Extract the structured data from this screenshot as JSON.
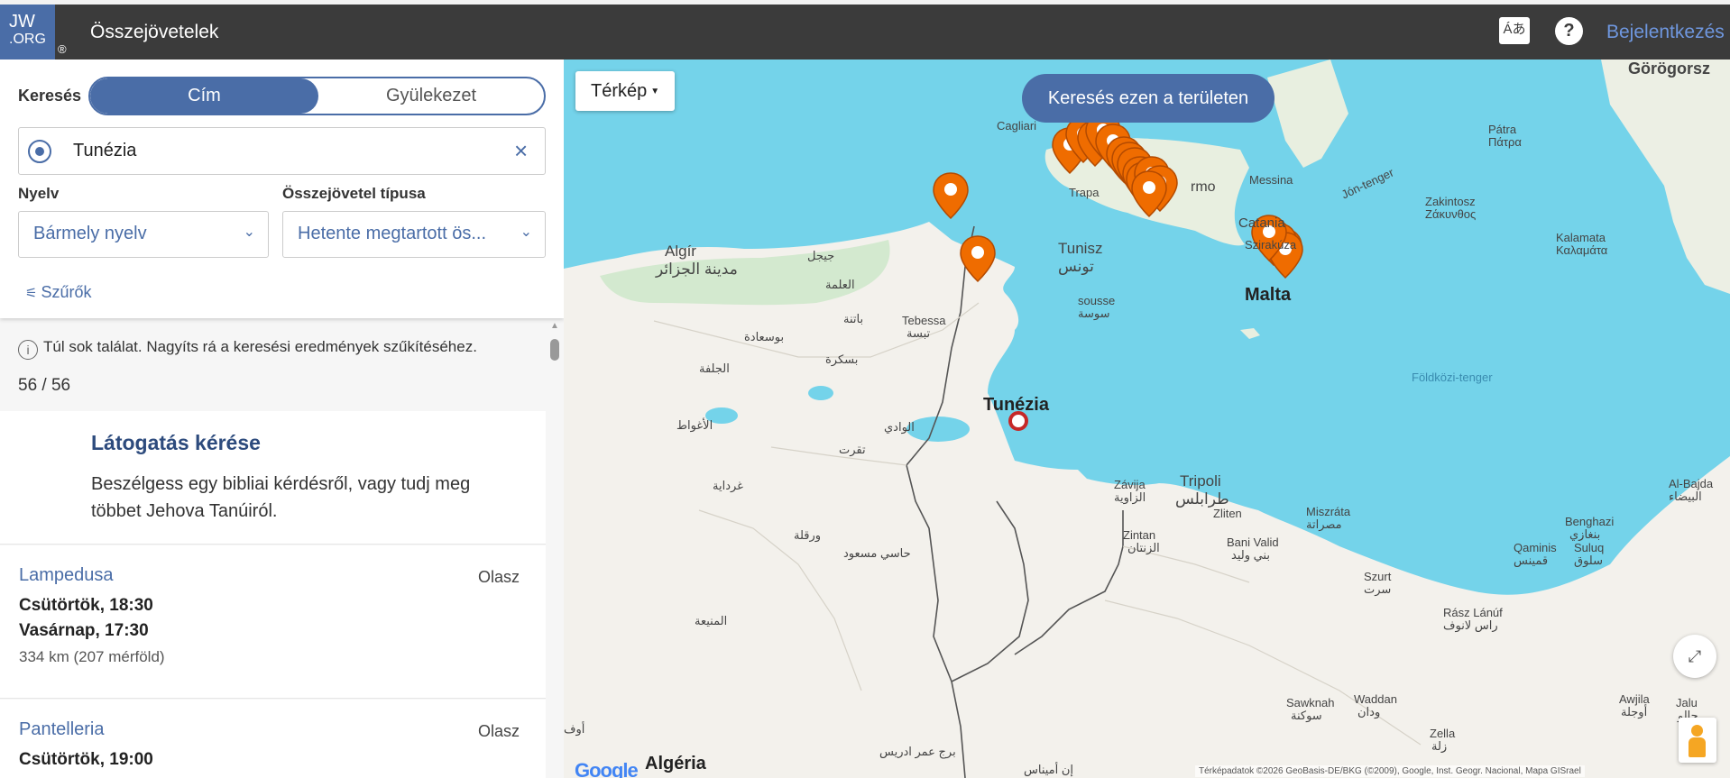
{
  "header": {
    "logo_line1": "JW",
    "logo_line2": ".ORG",
    "logo_reg": "®",
    "title": "Összejövetelek",
    "lang_icon_text": "Áあ",
    "help_icon_text": "?",
    "login": "Bejelentkezés"
  },
  "search": {
    "label": "Keresés",
    "mode_title": "Cím",
    "mode_congregation": "Gyülekezet",
    "value": "Tunézia",
    "clear_icon": "×"
  },
  "filters": {
    "language_label": "Nyelv",
    "language_value": "Bármely nyelv",
    "type_label": "Összejövetel típusa",
    "type_value": "Hetente megtartott ös...",
    "filters_button": "Szűrők"
  },
  "results": {
    "info": "Túl sok találat. Nagyíts rá a keresési eredmények szűkítéséhez.",
    "count": "56 / 56",
    "visit_title": "Látogatás kérése",
    "visit_desc": "Beszélgess egy bibliai kérdésről, vagy tudj meg többet Jehova Tanúiról.",
    "meetings": [
      {
        "name": "Lampedusa",
        "language": "Olasz",
        "time1": "Csütörtök, 18:30",
        "time2": "Vasárnap, 17:30",
        "distance": "334 km (207 mérföld)"
      },
      {
        "name": "Pantelleria",
        "language": "Olasz",
        "time1": "Csütörtök, 19:00"
      }
    ]
  },
  "map": {
    "type_button": "Térkép",
    "search_area_button": "Keresés ezen a területen",
    "google": "Google",
    "attribution": "Térképadatok ©2026 GeoBasis-DE/BKG (©2009), Google, Inst. Geogr. Nacional, Mapa GISrael",
    "labels": {
      "tunisia": "Tunézia",
      "malta": "Malta",
      "tunis": "Tunisz",
      "tunis_ar": "تونس",
      "algiers": "Algír",
      "algiers_ar": "مدينة الجزائر",
      "tripoli": "Tripoli",
      "tripoli_ar": "طرابلس",
      "catania": "Catania",
      "siracusa": "Szirakúza",
      "messina": "Messina",
      "palermo": "rmo",
      "trapani": "Trapa",
      "sousse": "sousse",
      "sousse_ar": "سوسة",
      "tebessa": "Tebessa",
      "tebessa_ar": "تبسة",
      "med_sea": "Földközi-tenger",
      "ionian": "Jón-tenger",
      "algeria": "Algéria",
      "zawiya": "Závija",
      "zawiya_ar": "الزاوية",
      "zliten": "Zliten",
      "misrata": "Miszráta",
      "misrata_ar": "مصراتة",
      "zintan": "Zintan",
      "zintan_ar": "الزنتان",
      "bani_walid": "Bani Valid",
      "bani_walid_ar": "بني وليد",
      "sirte": "Szurt",
      "sirte_ar": "سرت",
      "ras_lanuf": "Rász Lánúf",
      "ras_lanuf_ar": "راس لانوف",
      "benghazi": "Benghazi",
      "benghazi_ar": "بنغازي",
      "qaminis": "Qaminis",
      "qaminis_ar": "قمينس",
      "suluq": "Suluq",
      "suluq_ar": "سلوق",
      "al_bayda": "Al-Bajda",
      "al_bayda_ar": "البيضاء",
      "patra": "Pátra",
      "patra_gr": "Πάτρα",
      "zakynthos": "Zakintosz",
      "zakynthos_gr": "Ζάκυνθος",
      "kalamata": "Kalamata",
      "kalamata_gr": "Καλαμάτα",
      "gorog": "Görögorsz",
      "sawknah": "Sawknah",
      "sawknah_ar": "سوكنة",
      "waddan": "Waddan",
      "waddan_ar": "ودان",
      "zella": "Zella",
      "zella_ar": "زلة",
      "awjila": "Awjila",
      "awjila_ar": "أوجلة",
      "jalu": "Jalu",
      "jalu_ar": "جالو",
      "cagliari": "Cagliari",
      "ghardaia_ar": "غرداية",
      "ouargla_ar": "ورقلة",
      "hassi_ar": "حاسي مسعود",
      "eloued_ar": "الوادي",
      "touggourt_ar": "تقرت",
      "biskra_ar": "بسكرة",
      "djelfa_ar": "الجلفة",
      "laghouat_ar": "الأغواط",
      "batna_ar": "باتنة",
      "bousaada_ar": "بوسعادة",
      "eulma_ar": "العلمة",
      "jijel_ar": "جيجل",
      "menia_ar": "المنيعة",
      "bordj_ar": "برج عمر ادريس",
      "amenas_ar": "إن أميناس",
      "tamanrasset_partial": "أوف"
    }
  }
}
